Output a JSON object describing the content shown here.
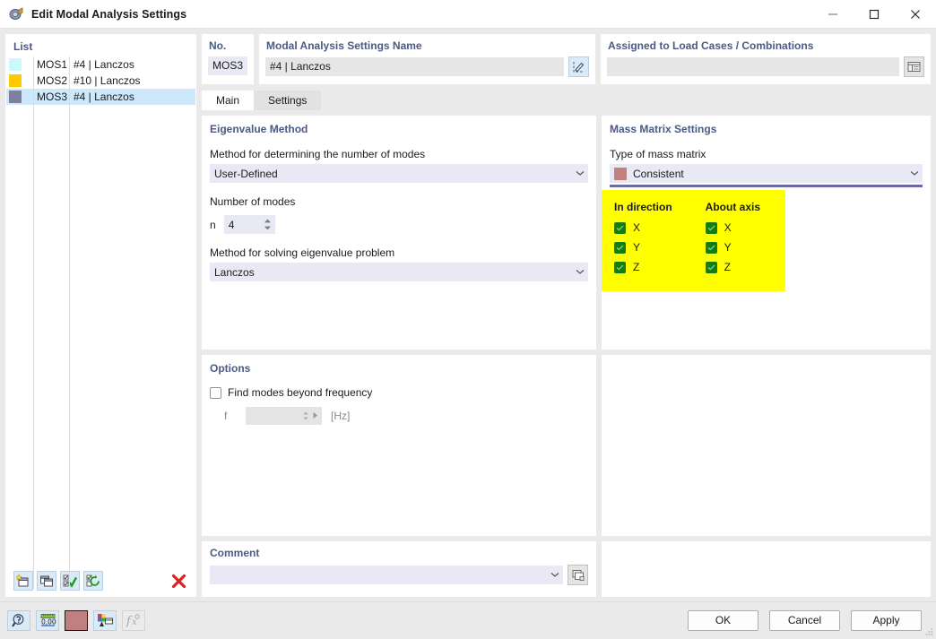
{
  "window": {
    "title": "Edit Modal Analysis Settings",
    "icon": "modal-analysis-icon",
    "controls": {
      "minimize": "minimize-icon",
      "maximize": "maximize-icon",
      "close": "close-icon"
    }
  },
  "list_panel": {
    "header": "List",
    "rows": [
      {
        "swatch": "#ccfafa",
        "key": "MOS1",
        "value": "#4 | Lanczos",
        "selected": false
      },
      {
        "swatch": "#ffc800",
        "key": "MOS2",
        "value": "#10 | Lanczos",
        "selected": false
      },
      {
        "swatch": "#7f7f9e",
        "key": "MOS3",
        "value": "#4 | Lanczos",
        "selected": true
      }
    ],
    "toolbar": [
      {
        "name": "new-item-button",
        "icon": "new-window-icon"
      },
      {
        "name": "copy-item-button",
        "icon": "copy-window-icon"
      },
      {
        "name": "select-all-button",
        "icon": "check-all-icon"
      },
      {
        "name": "refresh-selection-button",
        "icon": "refresh-check-icon"
      },
      {
        "name": "delete-item-button",
        "icon": "red-x-icon"
      }
    ]
  },
  "no_card": {
    "title": "No.",
    "value": "MOS3"
  },
  "name_card": {
    "title": "Modal Analysis Settings Name",
    "value": "#4 | Lanczos",
    "edit_button_icon": "edit-pencil-icon"
  },
  "assigned_card": {
    "title": "Assigned to Load Cases / Combinations",
    "value": "",
    "button_icon": "table-select-icon"
  },
  "tabs": [
    {
      "label": "Main",
      "active": true
    },
    {
      "label": "Settings",
      "active": false
    }
  ],
  "eigenvalue_method": {
    "title": "Eigenvalue Method",
    "method_modes_label": "Method for determining the number of modes",
    "method_modes_value": "User-Defined",
    "number_of_modes_label": "Number of modes",
    "n_symbol": "n",
    "n_value": "4",
    "method_solve_label": "Method for solving eigenvalue problem",
    "method_solve_value": "Lanczos"
  },
  "mass_matrix": {
    "title": "Mass Matrix Settings",
    "type_label": "Type of mass matrix",
    "type_value": "Consistent",
    "type_color": "#c08080",
    "underline_color": "#6b6bac",
    "highlight_color": "#ffff00",
    "in_direction_header": "In direction",
    "about_axis_header": "About axis",
    "in_direction": [
      {
        "label": "X",
        "checked": true
      },
      {
        "label": "Y",
        "checked": true
      },
      {
        "label": "Z",
        "checked": true
      }
    ],
    "about_axis": [
      {
        "label": "X",
        "checked": true
      },
      {
        "label": "Y",
        "checked": true
      },
      {
        "label": "Z",
        "checked": true
      }
    ]
  },
  "options": {
    "title": "Options",
    "find_modes_label": "Find modes beyond frequency",
    "find_modes_checked": false,
    "f_symbol": "f",
    "f_value": "",
    "f_unit": "[Hz]"
  },
  "comment": {
    "title": "Comment",
    "value": "",
    "button_icon": "copy-comment-icon"
  },
  "footer": {
    "tools": [
      {
        "name": "help-button",
        "icon": "question-magnifier-icon",
        "disabled": false
      },
      {
        "name": "units-button",
        "icon": "units-ruler-icon",
        "disabled": false
      },
      {
        "name": "color-swatch-button",
        "icon": "color-swatch-icon",
        "disabled": false,
        "color": "#c08080"
      },
      {
        "name": "display-properties-button",
        "icon": "display-properties-icon",
        "disabled": false
      },
      {
        "name": "formula-button",
        "icon": "function-fx-icon",
        "disabled": true
      }
    ],
    "ok_label": "OK",
    "cancel_label": "Cancel",
    "apply_label": "Apply"
  }
}
